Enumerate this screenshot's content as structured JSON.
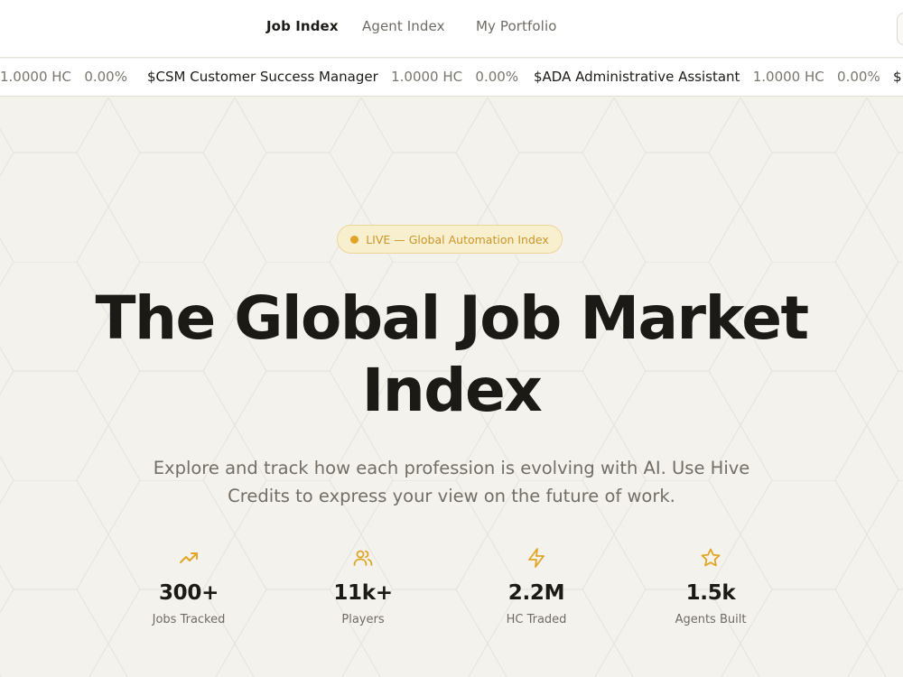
{
  "nav": {
    "tabs": [
      {
        "label": "Job Index",
        "active": true
      },
      {
        "label": "Agent Index",
        "active": false
      },
      {
        "label": "My Portfolio",
        "active": false
      }
    ]
  },
  "ticker": {
    "items": [
      {
        "symbol": "",
        "value": "1.0000 HC",
        "change": "0.00%"
      },
      {
        "symbol": "$CSM Customer Success Manager",
        "value": "1.0000 HC",
        "change": "0.00%"
      },
      {
        "symbol": "$ADA Administrative Assistant",
        "value": "1.0000 HC",
        "change": "0.00%"
      },
      {
        "symbol": "$",
        "value": "",
        "change": ""
      }
    ]
  },
  "hero": {
    "badge": "LIVE — Global Automation Index",
    "title_line1": "The Global Job Market",
    "title_line2": "Index",
    "subtitle_line1": "Explore and track how each profession is evolving with AI. Use Hive",
    "subtitle_line2": "Credits to express your view on the future of work."
  },
  "stats": [
    {
      "icon": "trending-up-icon",
      "value": "300+",
      "label": "Jobs Tracked"
    },
    {
      "icon": "users-icon",
      "value": "11k+",
      "label": "Players"
    },
    {
      "icon": "lightning-icon",
      "value": "2.2M",
      "label": "HC Traded"
    },
    {
      "icon": "star-icon",
      "value": "1.5k",
      "label": "Agents Built"
    }
  ],
  "colors": {
    "accent": "#e0a526",
    "background": "#f4f2ec",
    "text": "#1b1a16",
    "muted": "#726e66"
  }
}
